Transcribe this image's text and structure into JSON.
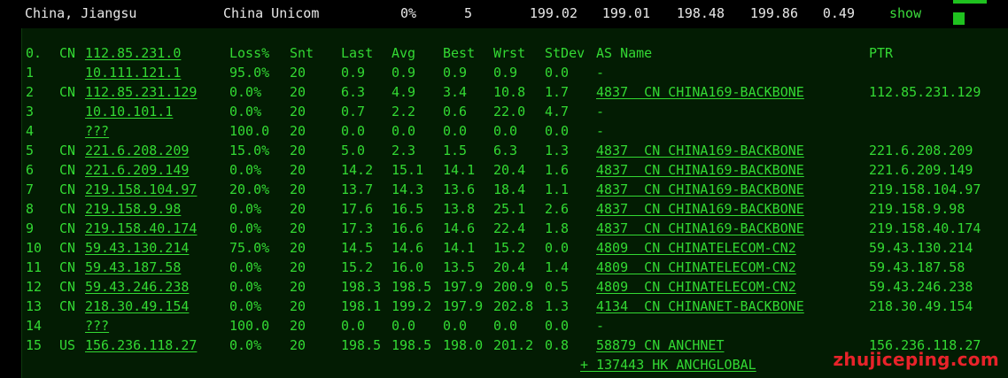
{
  "summary": {
    "location": "China, Jiangsu",
    "isp": "China Unicom",
    "loss": "0%",
    "sent": "5",
    "last": "199.02",
    "avg": "199.01",
    "best": "198.48",
    "worst": "199.86",
    "stdev": "0.49",
    "show_label": "show"
  },
  "table": {
    "headers": [
      "0.",
      "CN",
      "112.85.231.0",
      "Loss%",
      "Snt",
      "Last",
      "Avg",
      "Best",
      "Wrst",
      "StDev",
      "AS Name",
      "PTR"
    ],
    "rows": [
      {
        "hop": "1",
        "cc": "",
        "ip": "10.111.121.1",
        "loss": "95.0%",
        "snt": "20",
        "last": "0.9",
        "avg": "0.9",
        "best": "0.9",
        "wrst": "0.9",
        "stdev": "0.0",
        "asn": "-",
        "ptr": ""
      },
      {
        "hop": "2",
        "cc": "CN",
        "ip": "112.85.231.129",
        "loss": "0.0%",
        "snt": "20",
        "last": "6.3",
        "avg": "4.9",
        "best": "3.4",
        "wrst": "10.8",
        "stdev": "1.7",
        "asn": "4837  CN CHINA169-BACKBONE",
        "ptr": "112.85.231.129"
      },
      {
        "hop": "3",
        "cc": "",
        "ip": "10.10.101.1",
        "loss": "0.0%",
        "snt": "20",
        "last": "0.7",
        "avg": "2.2",
        "best": "0.6",
        "wrst": "22.0",
        "stdev": "4.7",
        "asn": "-",
        "ptr": ""
      },
      {
        "hop": "4",
        "cc": "",
        "ip": "???",
        "loss": "100.0",
        "snt": "20",
        "last": "0.0",
        "avg": "0.0",
        "best": "0.0",
        "wrst": "0.0",
        "stdev": "0.0",
        "asn": "-",
        "ptr": ""
      },
      {
        "hop": "5",
        "cc": "CN",
        "ip": "221.6.208.209",
        "loss": "15.0%",
        "snt": "20",
        "last": "5.0",
        "avg": "2.3",
        "best": "1.5",
        "wrst": "6.3",
        "stdev": "1.3",
        "asn": "4837  CN CHINA169-BACKBONE",
        "ptr": "221.6.208.209"
      },
      {
        "hop": "6",
        "cc": "CN",
        "ip": "221.6.209.149",
        "loss": "0.0%",
        "snt": "20",
        "last": "14.2",
        "avg": "15.1",
        "best": "14.1",
        "wrst": "20.4",
        "stdev": "1.6",
        "asn": "4837  CN CHINA169-BACKBONE",
        "ptr": "221.6.209.149"
      },
      {
        "hop": "7",
        "cc": "CN",
        "ip": "219.158.104.97",
        "loss": "20.0%",
        "snt": "20",
        "last": "13.7",
        "avg": "14.3",
        "best": "13.6",
        "wrst": "18.4",
        "stdev": "1.1",
        "asn": "4837  CN CHINA169-BACKBONE",
        "ptr": "219.158.104.97"
      },
      {
        "hop": "8",
        "cc": "CN",
        "ip": "219.158.9.98",
        "loss": "0.0%",
        "snt": "20",
        "last": "17.6",
        "avg": "16.5",
        "best": "13.8",
        "wrst": "25.1",
        "stdev": "2.6",
        "asn": "4837  CN CHINA169-BACKBONE",
        "ptr": "219.158.9.98"
      },
      {
        "hop": "9",
        "cc": "CN",
        "ip": "219.158.40.174",
        "loss": "0.0%",
        "snt": "20",
        "last": "17.3",
        "avg": "16.6",
        "best": "14.6",
        "wrst": "22.4",
        "stdev": "1.8",
        "asn": "4837  CN CHINA169-BACKBONE",
        "ptr": "219.158.40.174"
      },
      {
        "hop": "10",
        "cc": "CN",
        "ip": "59.43.130.214",
        "loss": "75.0%",
        "snt": "20",
        "last": "14.5",
        "avg": "14.6",
        "best": "14.1",
        "wrst": "15.2",
        "stdev": "0.0",
        "asn": "4809  CN CHINATELECOM-CN2",
        "ptr": "59.43.130.214"
      },
      {
        "hop": "11",
        "cc": "CN",
        "ip": "59.43.187.58",
        "loss": "0.0%",
        "snt": "20",
        "last": "15.2",
        "avg": "16.0",
        "best": "13.5",
        "wrst": "20.4",
        "stdev": "1.4",
        "asn": "4809  CN CHINATELECOM-CN2",
        "ptr": "59.43.187.58"
      },
      {
        "hop": "12",
        "cc": "CN",
        "ip": "59.43.246.238",
        "loss": "0.0%",
        "snt": "20",
        "last": "198.3",
        "avg": "198.5",
        "best": "197.9",
        "wrst": "200.9",
        "stdev": "0.5",
        "asn": "4809  CN CHINATELECOM-CN2",
        "ptr": "59.43.246.238"
      },
      {
        "hop": "13",
        "cc": "CN",
        "ip": "218.30.49.154",
        "loss": "0.0%",
        "snt": "20",
        "last": "198.1",
        "avg": "199.2",
        "best": "197.9",
        "wrst": "202.8",
        "stdev": "1.3",
        "asn": "4134  CN CHINANET-BACKBONE",
        "ptr": "218.30.49.154"
      },
      {
        "hop": "14",
        "cc": "",
        "ip": "???",
        "loss": "100.0",
        "snt": "20",
        "last": "0.0",
        "avg": "0.0",
        "best": "0.0",
        "wrst": "0.0",
        "stdev": "0.0",
        "asn": "-",
        "ptr": ""
      },
      {
        "hop": "15",
        "cc": "US",
        "ip": "156.236.118.27",
        "loss": "0.0%",
        "snt": "20",
        "last": "198.5",
        "avg": "198.5",
        "best": "198.0",
        "wrst": "201.2",
        "stdev": "0.8",
        "asn": "58879 CN ANCHNET",
        "ptr": "156.236.118.27"
      }
    ],
    "extra_asn": "+ 137443 HK ANCHGLOBAL"
  },
  "watermark": "zhujiceping.com",
  "colors": {
    "background": "#000000",
    "panel": "#031c03",
    "text_green": "#33d933",
    "summary_text": "#e8e8e8",
    "watermark": "#e8232a"
  }
}
